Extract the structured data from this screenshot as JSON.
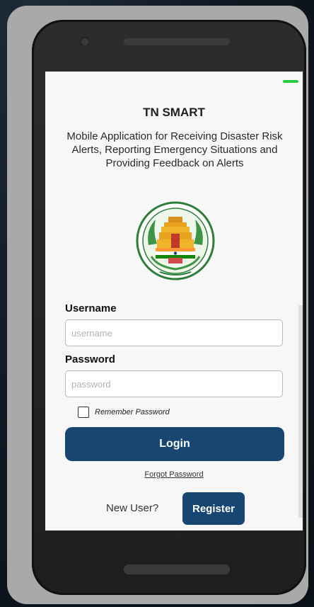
{
  "app": {
    "title": "TN SMART",
    "subtitle": "Mobile Application for Receiving Disaster Risk Alerts, Reporting Emergency Situations and Providing Feedback on Alerts"
  },
  "emblem": {
    "icon": "tamil-nadu-emblem-icon"
  },
  "login_form": {
    "username_label": "Username",
    "username_placeholder": "username",
    "username_value": "",
    "password_label": "Password",
    "password_placeholder": "password",
    "password_value": "",
    "remember_label": "Remember Password",
    "remember_checked": false,
    "login_label": "Login",
    "forgot_label": "Forgot Password"
  },
  "register": {
    "prompt": "New User?",
    "button_label": "Register"
  },
  "colors": {
    "primary_button": "#174673",
    "status_indicator": "#2ecc40",
    "screen_background": "#f7f7f7"
  }
}
